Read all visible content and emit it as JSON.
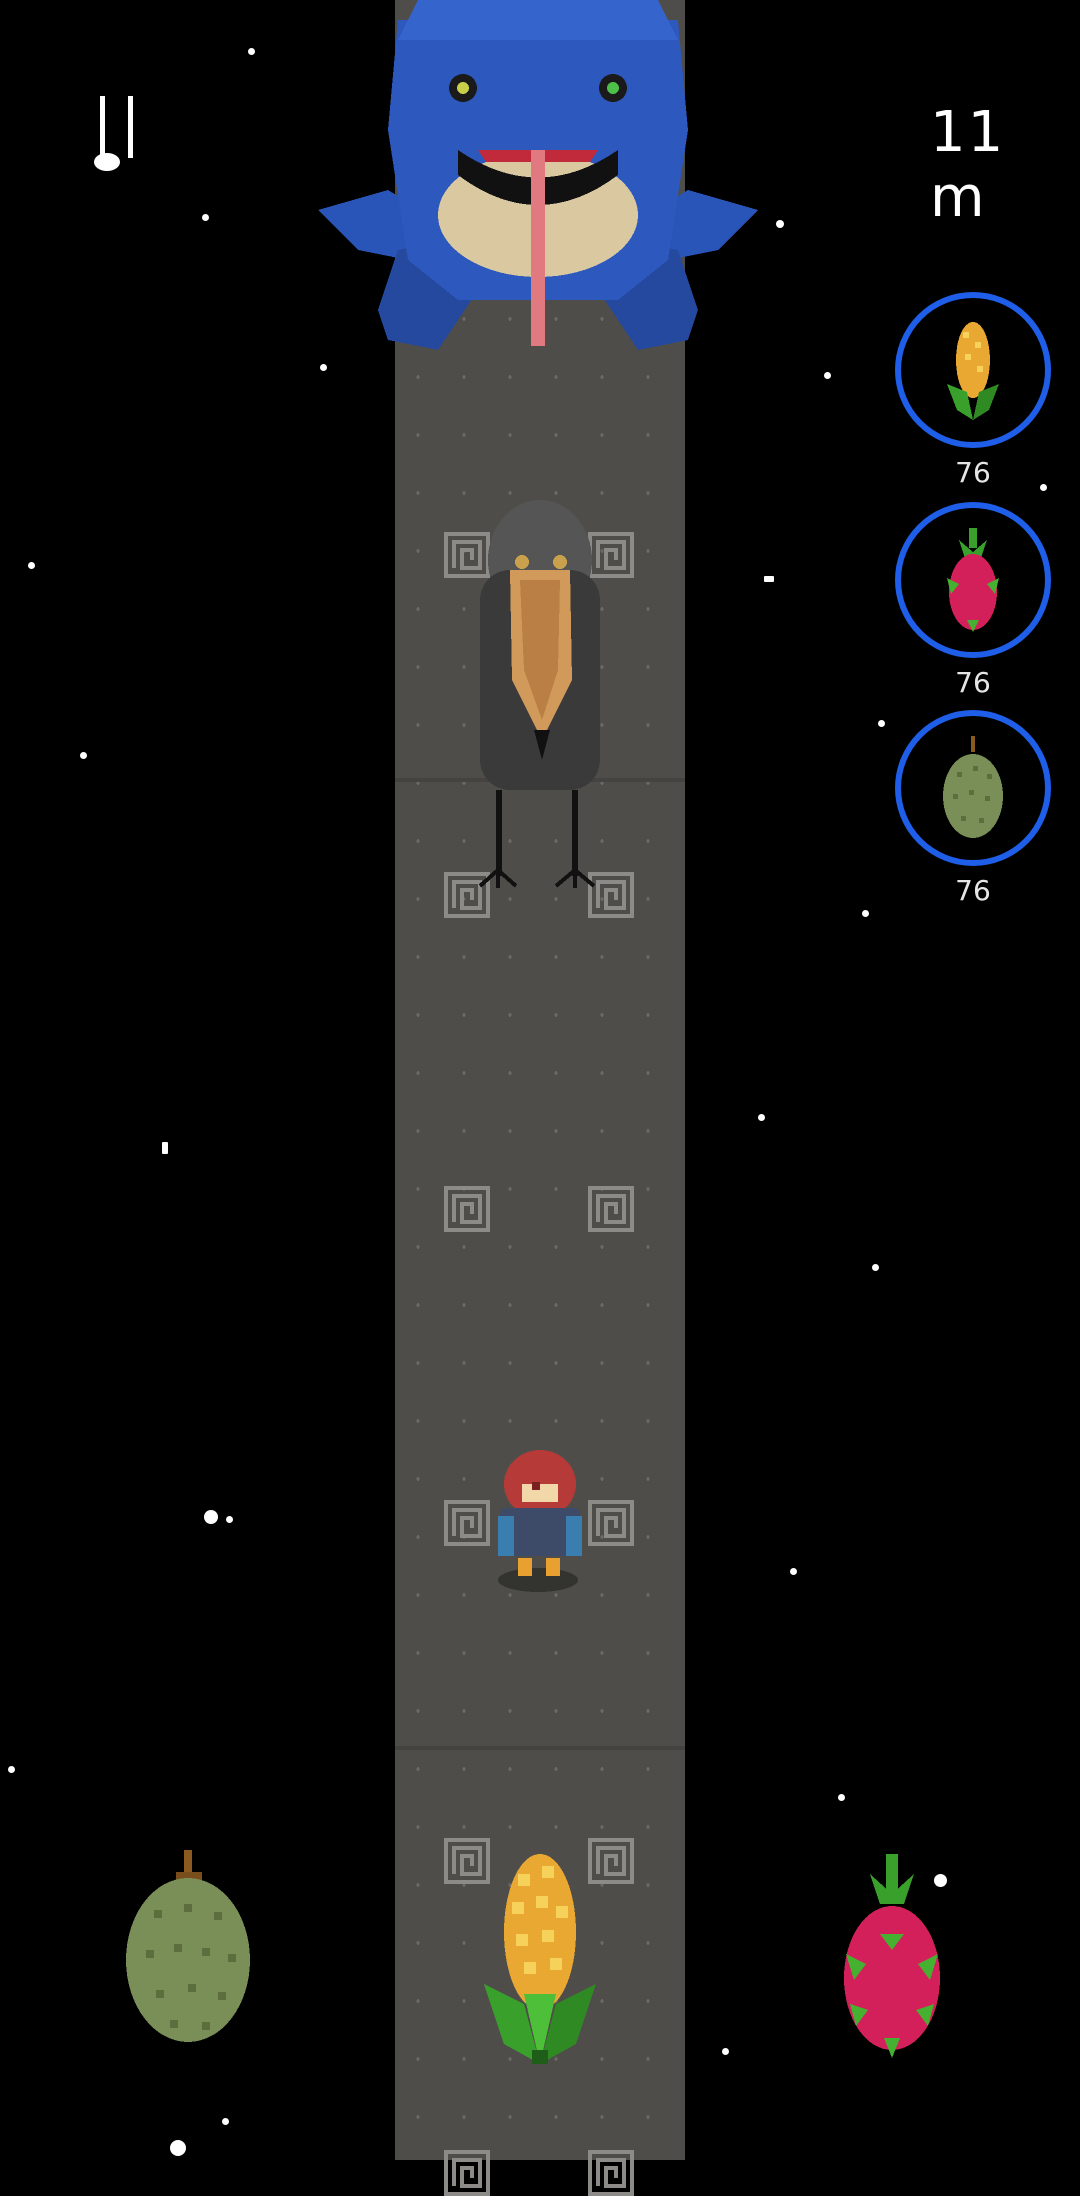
{
  "hud": {
    "pause_icon": "pause-icon",
    "distance": "11 m"
  },
  "inventory": [
    {
      "item": "corn",
      "count": "76",
      "icon": "corn-icon"
    },
    {
      "item": "dragon-fruit",
      "count": "76",
      "icon": "dragon-fruit-icon"
    },
    {
      "item": "durian",
      "count": "76",
      "icon": "durian-icon"
    }
  ],
  "scene": {
    "boss": "blue-frog",
    "enemy": "shoebill-bird",
    "player": "red-hair-kid",
    "pickups": [
      "durian",
      "corn",
      "dragon-fruit"
    ]
  },
  "colors": {
    "ring": "#1f5ee8",
    "road": "#4e4d49",
    "frog": "#2a55b8"
  }
}
